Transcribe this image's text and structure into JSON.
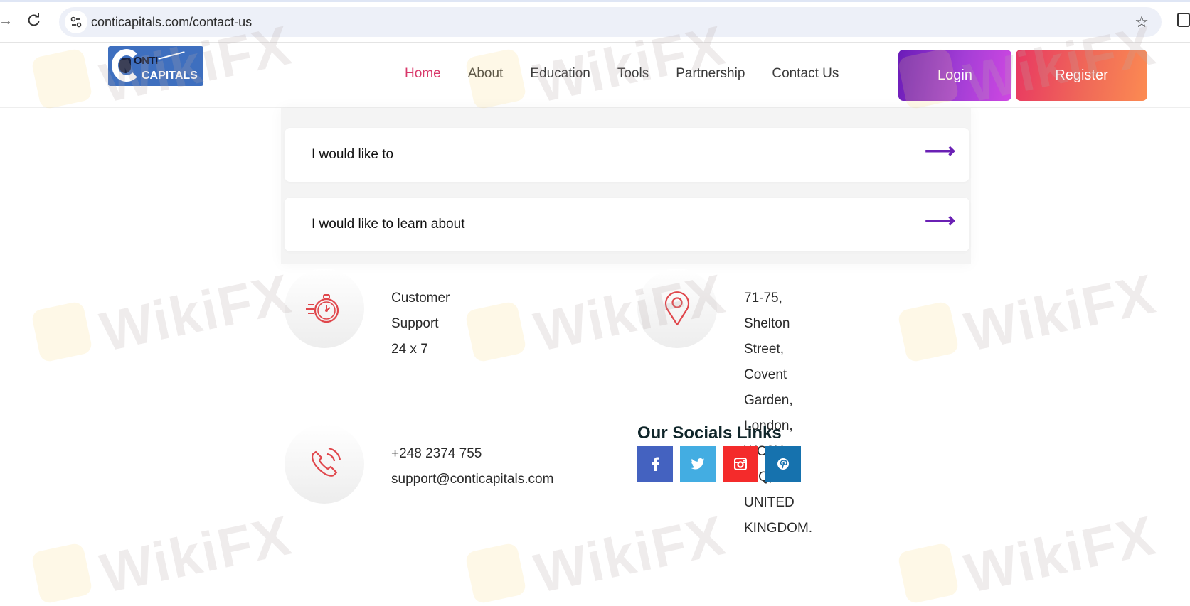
{
  "browser": {
    "url": "conticapitals.com/contact-us"
  },
  "header": {
    "logo": {
      "line1": "ONTI",
      "line2": "CAPITALS"
    },
    "nav": [
      {
        "label": "Home",
        "active": true
      },
      {
        "label": "About",
        "active": false
      },
      {
        "label": "Education",
        "active": false
      },
      {
        "label": "Tools",
        "active": false
      },
      {
        "label": "Partnership",
        "active": false
      },
      {
        "label": "Contact Us",
        "active": false
      }
    ],
    "login_label": "Login",
    "register_label": "Register"
  },
  "form": {
    "selects": [
      {
        "label": "I would like to",
        "icon": "arrow-right-icon"
      },
      {
        "label": "I would like to learn about",
        "icon": "arrow-right-icon"
      }
    ]
  },
  "contact": {
    "support": {
      "icon": "stopwatch-icon",
      "lines": [
        "Customer Support",
        "24 x 7"
      ]
    },
    "address": {
      "icon": "location-pin-icon",
      "lines": [
        "71-75, Shelton Street, Covent",
        "Garden,",
        "London, WC2H 9JQ, UNITED",
        "KINGDOM."
      ]
    },
    "phone": {
      "icon": "phone-icon",
      "lines": [
        "+248 2374 755",
        "support@conticapitals.com"
      ]
    }
  },
  "socials": {
    "title": "Our Socials Links",
    "links": [
      {
        "name": "facebook",
        "glyph": "f",
        "color": "#4462c0"
      },
      {
        "name": "twitter",
        "glyph": "t",
        "color": "#43ade2"
      },
      {
        "name": "instagram",
        "glyph": "ig",
        "color": "#f42b2b"
      },
      {
        "name": "pinterest",
        "glyph": "p",
        "color": "#1672ae"
      }
    ]
  },
  "watermark": "WikiFX",
  "colors": {
    "nav_active": "#d8386a",
    "arrow": "#6a20b4",
    "icon_red": "#e0474c"
  }
}
